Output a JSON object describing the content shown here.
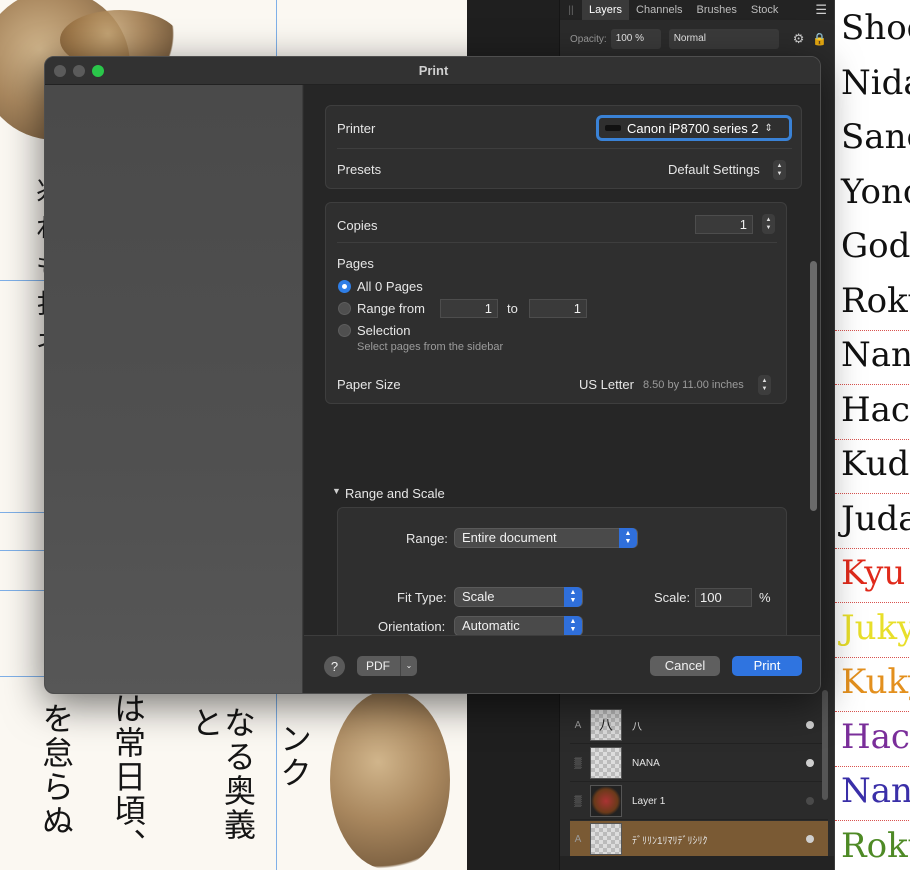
{
  "dialog": {
    "title": "Print",
    "printer_label": "Printer",
    "printer_value": "Canon iP8700 series 2",
    "presets_label": "Presets",
    "presets_value": "Default Settings",
    "copies_label": "Copies",
    "copies_value": "1",
    "pages_label": "Pages",
    "pages_options": [
      "All 0 Pages",
      "Range from",
      "Selection"
    ],
    "range_to_label": "to",
    "range_from_value": "1",
    "range_to_value": "1",
    "selection_hint": "Select pages from the sidebar",
    "paper_size_label": "Paper Size",
    "paper_size_value": "US Letter",
    "paper_size_detail": "8.50 by 11.00 inches",
    "section_range_scale": "Range and Scale",
    "range_label": "Range:",
    "range_value": "Entire document",
    "fit_type_label": "Fit Type:",
    "fit_type_value": "Scale",
    "scale_label": "Scale:",
    "scale_value": "100",
    "scale_unit": "%",
    "orientation_label": "Orientation:",
    "orientation_value": "Automatic",
    "help_label": "?",
    "pdf_label": "PDF",
    "cancel_label": "Cancel",
    "print_label": "Print"
  },
  "layers_panel": {
    "tabs": [
      "Layers",
      "Channels",
      "Brushes",
      "Stock"
    ],
    "active_tab": "Layers",
    "opacity_label": "Opacity:",
    "opacity_value": "100 %",
    "blend_mode": "Normal",
    "layers": [
      {
        "lead": "A",
        "thumb": "八",
        "name": "八",
        "visible": true
      },
      {
        "lead": "▒",
        "thumb": "",
        "name": "NANA",
        "visible": true
      },
      {
        "lead": "▒",
        "thumb": "",
        "name": "Layer 1",
        "visible": false
      },
      {
        "lead": "A",
        "thumb": "",
        "name": "ﾃﾞﾘﾘﾝ1ﾘﾏﾘﾃﾞﾘｼﾘｸ",
        "visible": true,
        "selected": true
      }
    ]
  },
  "font_list": {
    "words": [
      {
        "text": "Shod",
        "color": "#111111"
      },
      {
        "text": "Nida",
        "color": "#111111"
      },
      {
        "text": "Sanc",
        "color": "#111111"
      },
      {
        "text": "Yonc",
        "color": "#111111"
      },
      {
        "text": "God",
        "color": "#111111"
      },
      {
        "text": "Roku",
        "color": "#111111"
      },
      {
        "text": "Nan",
        "color": "#111111"
      },
      {
        "text": "Hacl",
        "color": "#111111"
      },
      {
        "text": "Kuda",
        "color": "#111111"
      },
      {
        "text": "Juda",
        "color": "#111111"
      },
      {
        "text": "Kyu",
        "color": "#e02a1b"
      },
      {
        "text": "Juky",
        "color": "#e8df2a"
      },
      {
        "text": "Kuky",
        "color": "#e3901e"
      },
      {
        "text": "Hacl",
        "color": "#7a2e9a"
      },
      {
        "text": "Nan",
        "color": "#3a2fa8"
      },
      {
        "text": "Roku",
        "color": "#4e8a25"
      }
    ]
  },
  "canvas": {
    "kanji_columns": [
      "を怠らぬ",
      "は常日頃、",
      "なる奥義と",
      "ンク"
    ],
    "left_glyphs": [
      "兆",
      "れ",
      "も",
      "扌",
      "ネ"
    ]
  }
}
